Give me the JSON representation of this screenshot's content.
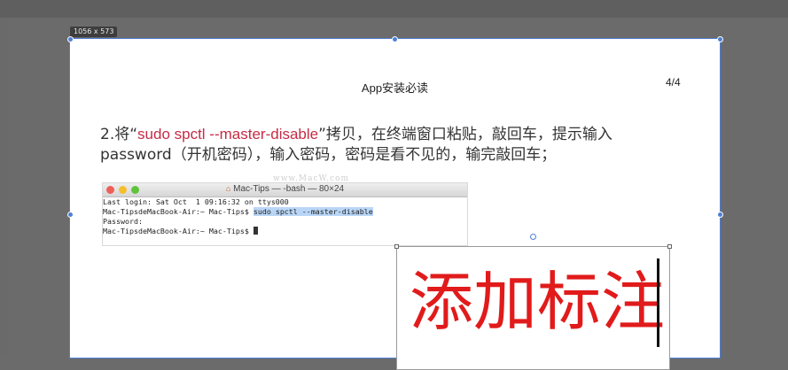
{
  "canvas": {
    "size_label": "1056 x 573"
  },
  "page": {
    "title": "App安装必读",
    "page_number": "4/4",
    "instruction": {
      "prefix": "2.将“",
      "command": "sudo spctl --master-disable",
      "suffix": "”拷贝，在终端窗口粘贴，敲回车，提示输入",
      "line2": "password（开机密码），输入密码，密码是看不见的，输完敲回车；"
    }
  },
  "terminal": {
    "title": "Mac-Tips — -bash — 80×24",
    "home_icon": "house-icon",
    "lines": {
      "login": "Last login: Sat Oct  1 09:16:32 on ttys000",
      "prompt1": "Mac-TipsdeMacBook-Air:~ Mac-Tips$ ",
      "command": "sudo spctl --master-disable",
      "password": "Password:",
      "prompt2": "Mac-TipsdeMacBook-Air:~ Mac-Tips$ "
    },
    "watermark": "www.MacW.com"
  },
  "annotation": {
    "text": "添加标注",
    "color": "#e11b1b"
  },
  "colors": {
    "selection": "#4f7fd6",
    "command_red": "#c62b45"
  }
}
